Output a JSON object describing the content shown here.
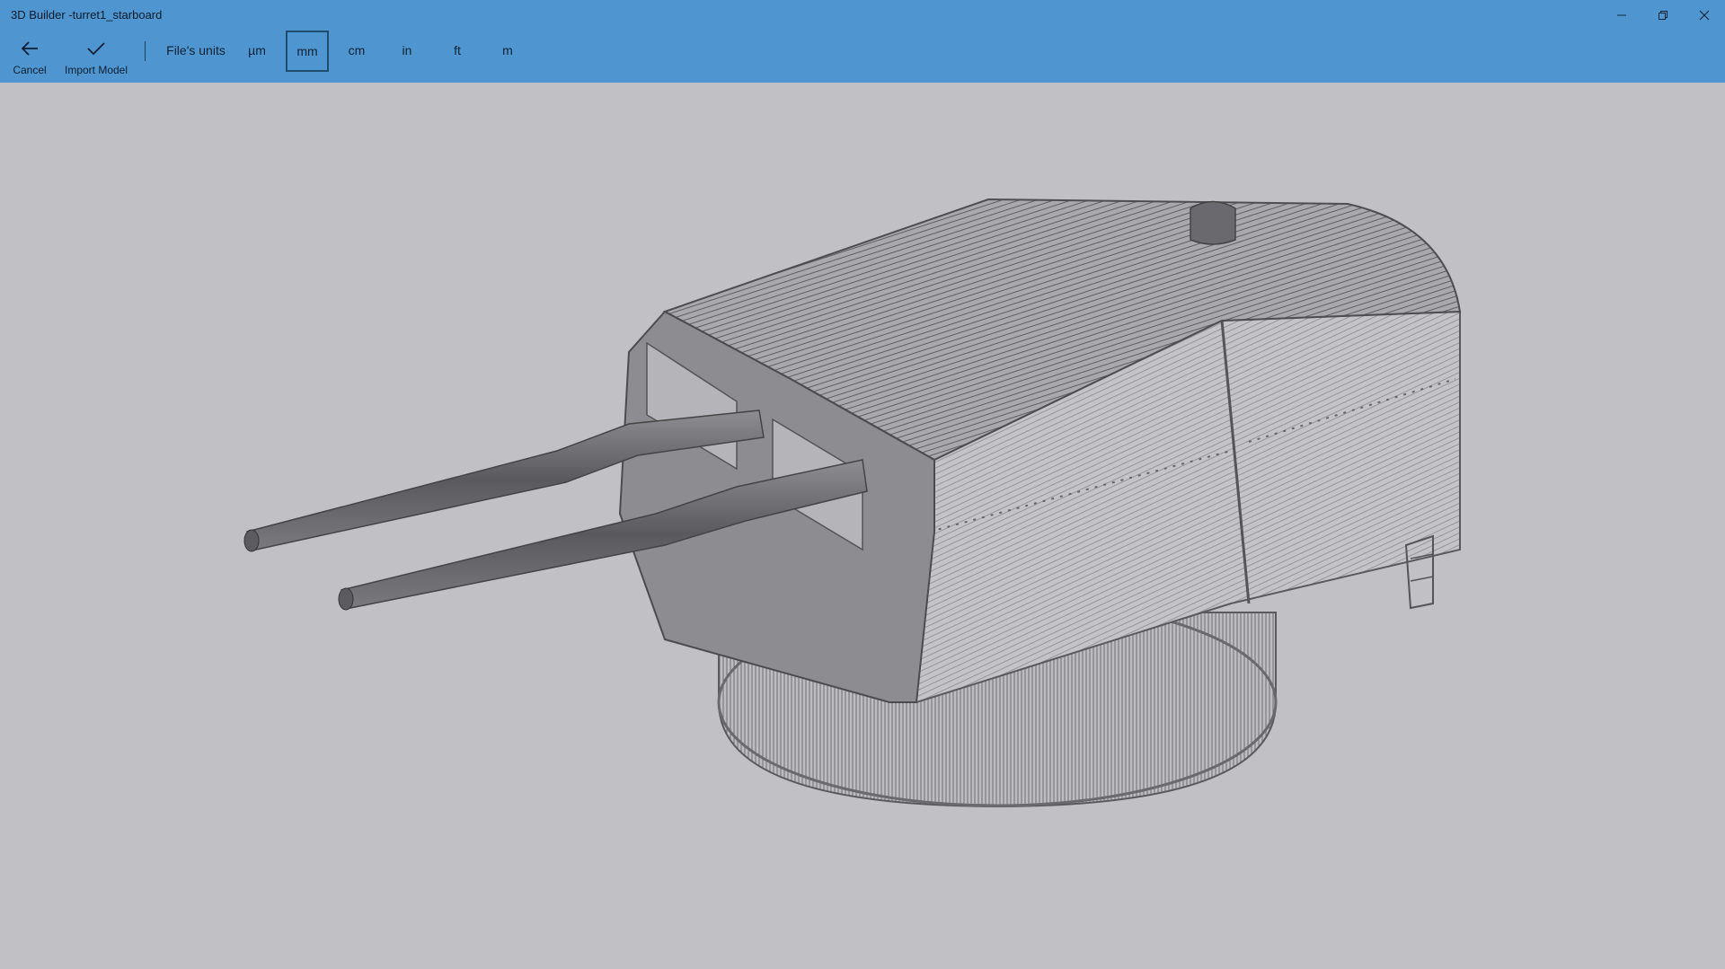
{
  "window": {
    "title": "3D Builder -turret1_starboard",
    "controls": {
      "minimize_icon": "minimize-icon",
      "maximize_icon": "restore-icon",
      "close_icon": "close-icon"
    }
  },
  "toolbar": {
    "cancel_label": "Cancel",
    "import_label": "Import Model",
    "units_label": "File's units",
    "units": [
      "µm",
      "mm",
      "cm",
      "in",
      "ft",
      "m"
    ],
    "selected_unit": "mm"
  },
  "colors": {
    "accent": "#4f96d1",
    "viewport_bg": "#c1c0c4",
    "model_gray": "#6f6f73"
  }
}
